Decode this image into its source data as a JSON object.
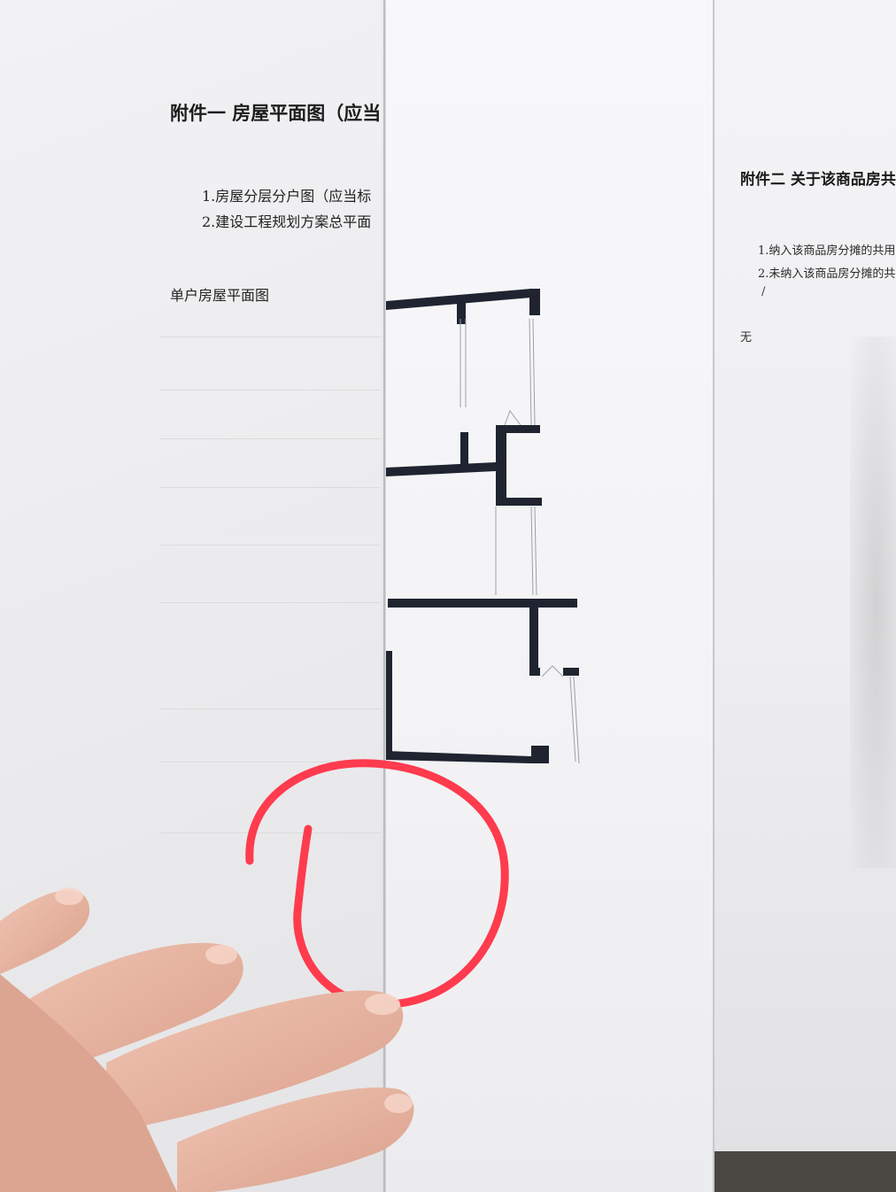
{
  "attachment_one": {
    "title": "附件一 房屋平面图（应当",
    "items": [
      "1.房屋分层分户图（应当标",
      "2.建设工程规划方案总平面"
    ],
    "subtitle": "单户房屋平面图"
  },
  "attachment_two": {
    "title": "附件二 关于该商品房共",
    "items": [
      "1.纳入该商品房分摊的共用",
      "2.未纳入该商品房分摊的共"
    ],
    "slash": "/",
    "none": "无"
  },
  "colors": {
    "wall": "#1f2430",
    "annotation": "#ff3b4e",
    "paper": "#f4f4f6",
    "skin": "#e9b6a3"
  }
}
